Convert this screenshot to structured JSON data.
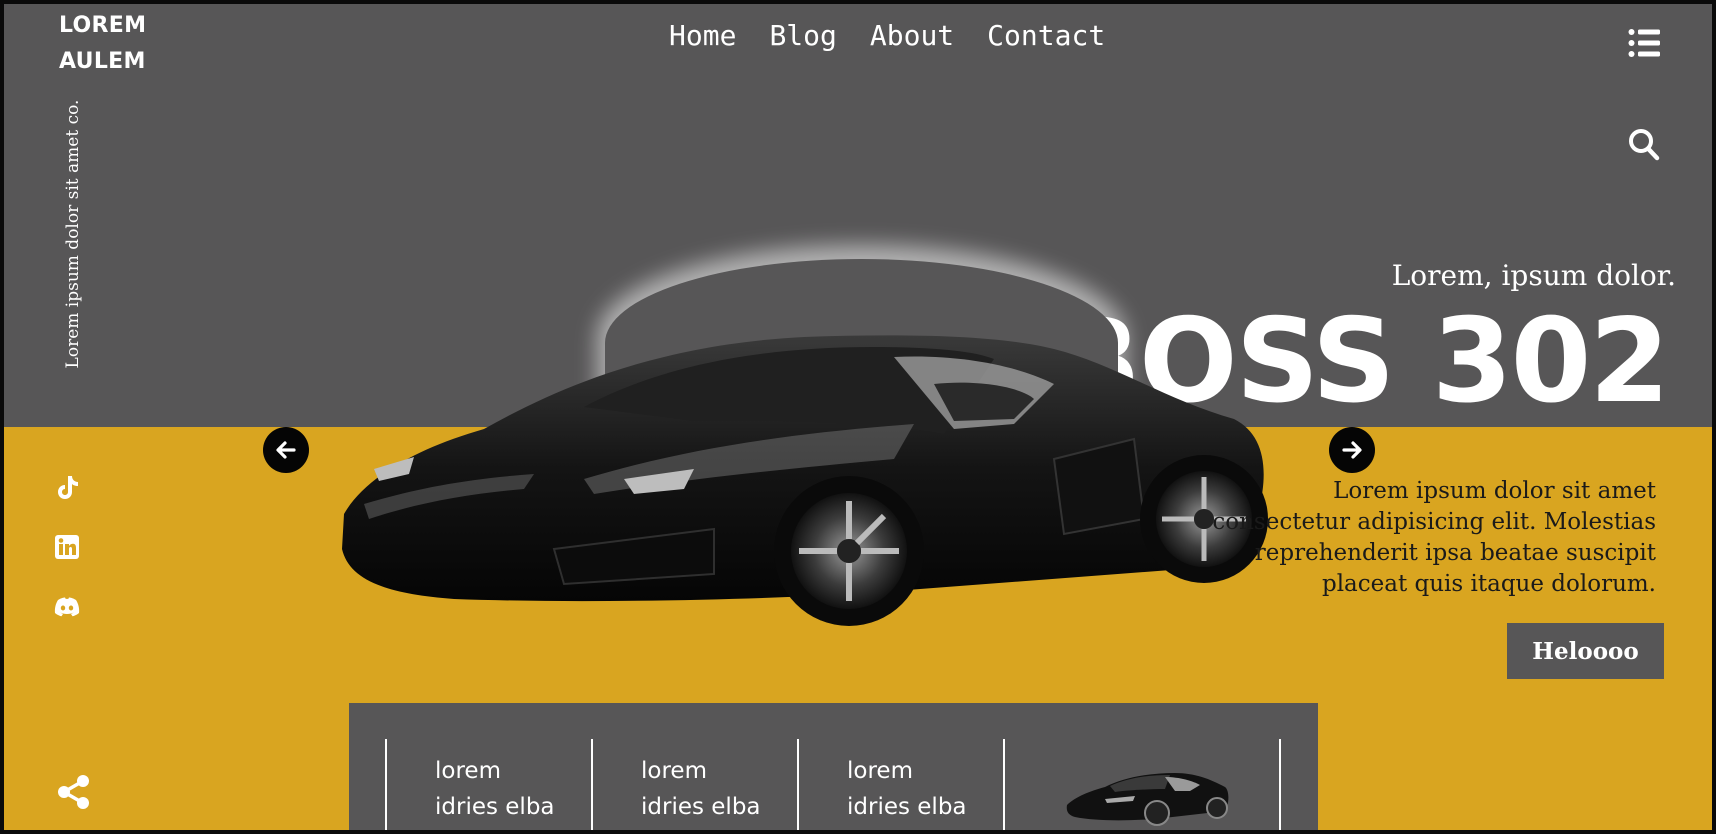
{
  "logo": {
    "line1": "LOREM",
    "line2": "AULEM"
  },
  "nav": {
    "items": [
      "Home",
      "Blog",
      "About",
      "Contact"
    ]
  },
  "header": {
    "menu_icon": "list-icon",
    "search_icon": "search-icon"
  },
  "sidebar": {
    "vertical_text": "Lorem ipsum dolor sit amet co.",
    "social_icons": [
      "tiktok-icon",
      "linkedin-icon",
      "discord-icon"
    ],
    "share_icon": "share-icon"
  },
  "hero": {
    "subtitle": "Lorem, ipsum dolor.",
    "title": "BOSS 302",
    "description": "Lorem ipsum dolor sit amet consectetur adipisicing elit. Molestias reprehenderit ipsa beatae suscipit placeat quis itaque dolorum.",
    "cta_label": "Heloooo",
    "prev_icon": "arrow-left-icon",
    "next_icon": "arrow-right-icon"
  },
  "panel": {
    "items": [
      {
        "line1": "lorem",
        "line2": "idries elba"
      },
      {
        "line1": "lorem",
        "line2": "idries elba"
      },
      {
        "line1": "lorem",
        "line2": "idries elba"
      }
    ]
  },
  "colors": {
    "gray": "#575657",
    "gold": "#d9a520",
    "white": "#ffffff",
    "black": "#050505"
  }
}
